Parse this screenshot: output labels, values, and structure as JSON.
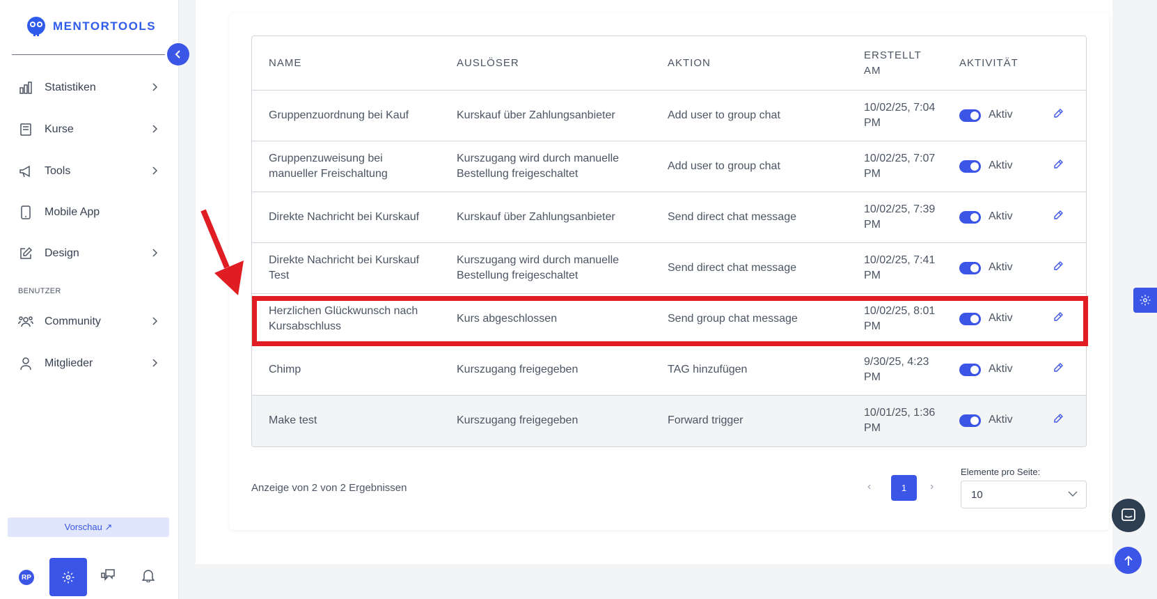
{
  "brand": {
    "name": "MENTORTOOLS",
    "color": "#2f5bea"
  },
  "sidebar": {
    "items": [
      {
        "label": "Statistiken",
        "icon": "bar-chart-icon",
        "has_chevron": true
      },
      {
        "label": "Kurse",
        "icon": "book-icon",
        "has_chevron": true
      },
      {
        "label": "Tools",
        "icon": "megaphone-icon",
        "has_chevron": true
      },
      {
        "label": "Mobile App",
        "icon": "mobile-icon",
        "has_chevron": false
      },
      {
        "label": "Design",
        "icon": "edit-icon",
        "has_chevron": true
      }
    ],
    "section_label": "BENUTZER",
    "user_items": [
      {
        "label": "Community",
        "icon": "users-icon",
        "has_chevron": true
      },
      {
        "label": "Mitglieder",
        "icon": "user-icon",
        "has_chevron": true
      }
    ],
    "preview_label": "Vorschau ↗",
    "avatar_initials": "RP"
  },
  "table": {
    "headers": {
      "name": "NAME",
      "trigger": "AUSLÖSER",
      "action": "AKTION",
      "created_line1": "ERSTELLT",
      "created_line2": "AM",
      "activity": "AKTIVITÄT"
    },
    "rows": [
      {
        "name_l1": "Gruppenzuordnung bei Kauf",
        "name_l2": "",
        "trig_l1": "Kurskauf über Zahlungsanbieter",
        "trig_l2": "",
        "action": "Add user to group chat",
        "date_l1": "10/02/25, 7:04",
        "date_l2": "PM",
        "status": "Aktiv",
        "active": true
      },
      {
        "name_l1": "Gruppenzuweisung bei",
        "name_l2": "manueller Freischaltung",
        "trig_l1": "Kurszugang wird durch manuelle",
        "trig_l2": "Bestellung freigeschaltet",
        "action": "Add user to group chat",
        "date_l1": "10/02/25, 7:07",
        "date_l2": "PM",
        "status": "Aktiv",
        "active": true
      },
      {
        "name_l1": "Direkte Nachricht bei Kurskauf",
        "name_l2": "",
        "trig_l1": "Kurskauf über Zahlungsanbieter",
        "trig_l2": "",
        "action": "Send direct chat message",
        "date_l1": "10/02/25, 7:39",
        "date_l2": "PM",
        "status": "Aktiv",
        "active": true
      },
      {
        "name_l1": "Direkte Nachricht bei Kurskauf",
        "name_l2": "Test",
        "trig_l1": "Kurszugang wird durch manuelle",
        "trig_l2": "Bestellung freigeschaltet",
        "action": "Send direct chat message",
        "date_l1": "10/02/25, 7:41",
        "date_l2": "PM",
        "status": "Aktiv",
        "active": true
      },
      {
        "name_l1": "Herzlichen Glückwunsch nach",
        "name_l2": "Kursabschluss",
        "trig_l1": "Kurs abgeschlossen",
        "trig_l2": "",
        "action": "Send group chat message",
        "date_l1": "10/02/25, 8:01",
        "date_l2": "PM",
        "status": "Aktiv",
        "active": true
      },
      {
        "name_l1": "Chimp",
        "name_l2": "",
        "trig_l1": "Kurszugang freigegeben",
        "trig_l2": "",
        "action": "TAG hinzufügen",
        "date_l1": "9/30/25, 4:23",
        "date_l2": "PM",
        "status": "Aktiv",
        "active": true
      },
      {
        "name_l1": "Make test",
        "name_l2": "",
        "trig_l1": "Kurszugang freigegeben",
        "trig_l2": "",
        "action": "Forward trigger",
        "date_l1": "10/01/25, 1:36",
        "date_l2": "PM",
        "status": "Aktiv",
        "active": true
      }
    ]
  },
  "footer": {
    "result_text": "Anzeige von 2 von 2 Ergebnissen",
    "page": "1",
    "prev": "‹",
    "next": "›",
    "per_page_label": "Elemente pro Seite:",
    "per_page_value": "10"
  },
  "colors": {
    "accent": "#3b55e6",
    "highlight": "#e11d24",
    "chat_fab": "#2d3e50"
  }
}
